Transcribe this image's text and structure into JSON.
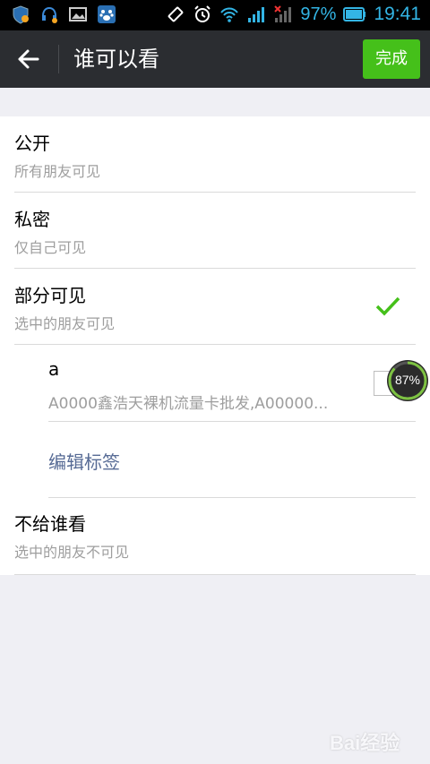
{
  "status_bar": {
    "battery": "97%",
    "time": "19:41"
  },
  "toolbar": {
    "title": "谁可以看",
    "done_label": "完成"
  },
  "options": [
    {
      "title": "公开",
      "subtitle": "所有朋友可见",
      "selected": false
    },
    {
      "title": "私密",
      "subtitle": "仅自己可见",
      "selected": false
    },
    {
      "title": "部分可见",
      "subtitle": "选中的朋友可见",
      "selected": true
    },
    {
      "title": "不给谁看",
      "subtitle": "选中的朋友不可见",
      "selected": false
    }
  ],
  "tag": {
    "name": "a",
    "members": "A0000鑫浩天裸机流量卡批发,A00000..."
  },
  "edit_tags_label": "编辑标签",
  "overlay_progress": "87%",
  "watermark": "Bai经验",
  "colors": {
    "toolbar_bg": "#2b2d31",
    "done_green": "#45c01a",
    "check_green": "#45c01a",
    "link_blue": "#576b95",
    "status_blue": "#33b5e5"
  }
}
